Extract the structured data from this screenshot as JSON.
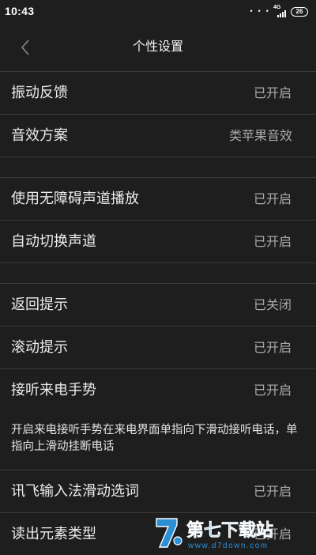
{
  "status_bar": {
    "time": "10:43",
    "dots": "• • •",
    "network": "4G",
    "battery": "26"
  },
  "header": {
    "title": "个性设置",
    "back_icon": "chevron-left-icon"
  },
  "rows": [
    {
      "label": "振动反馈",
      "value": "已开启"
    },
    {
      "label": "音效方案",
      "value": "类苹果音效"
    },
    {
      "label": "使用无障碍声道播放",
      "value": "已开启"
    },
    {
      "label": "自动切换声道",
      "value": "已开启"
    },
    {
      "label": "返回提示",
      "value": "已关闭"
    },
    {
      "label": "滚动提示",
      "value": "已开启"
    },
    {
      "label": "接听来电手势",
      "value": "已开启"
    },
    {
      "label": "讯飞输入法滑动选词",
      "value": "已开启"
    },
    {
      "label": "读出元素类型",
      "value": "已开启"
    }
  ],
  "gesture_description": "开启来电接听手势在来电界面单指向下滑动接听电话，单指向上滑动挂断电话",
  "watermark": {
    "brand": "第七下载站",
    "url": "www.d7down.com"
  }
}
